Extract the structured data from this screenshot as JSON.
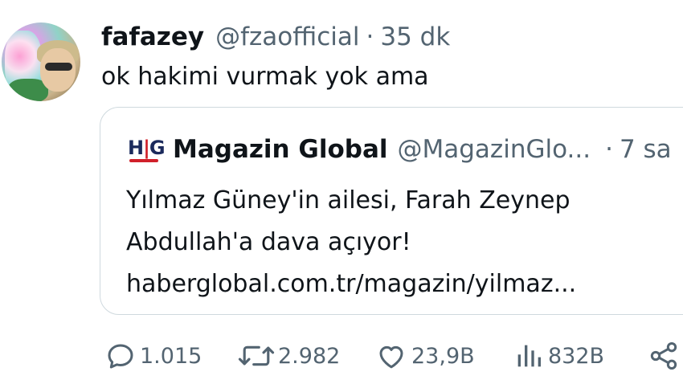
{
  "tweet": {
    "author_name": "fafazey",
    "author_handle": "@fzaofficial",
    "separator": "·",
    "time": "35 dk",
    "text": "ok hakimi vurmak yok ama"
  },
  "quoted": {
    "logo_text": "HG",
    "author_name": "Magazin Global",
    "author_handle": "@MagazinGlo...",
    "separator": "·",
    "time": "7 sa",
    "lines": [
      "Yılmaz Güney'in ailesi, Farah Zeynep",
      "Abdullah'a dava açıyor!",
      "haberglobal.com.tr/magazin/yilmaz..."
    ]
  },
  "actions": {
    "replies": "1.015",
    "retweets": "2.982",
    "likes": "23,9B",
    "views": "832B",
    "reply_icon": "reply-icon",
    "retweet_icon": "retweet-icon",
    "like_icon": "heart-icon",
    "views_icon": "views-icon",
    "share_icon": "share-icon"
  },
  "colors": {
    "text": "#0f1419",
    "muted": "#536471",
    "border": "#cfd9de",
    "logo_red": "#d0202a",
    "logo_navy": "#1b2a5c"
  }
}
